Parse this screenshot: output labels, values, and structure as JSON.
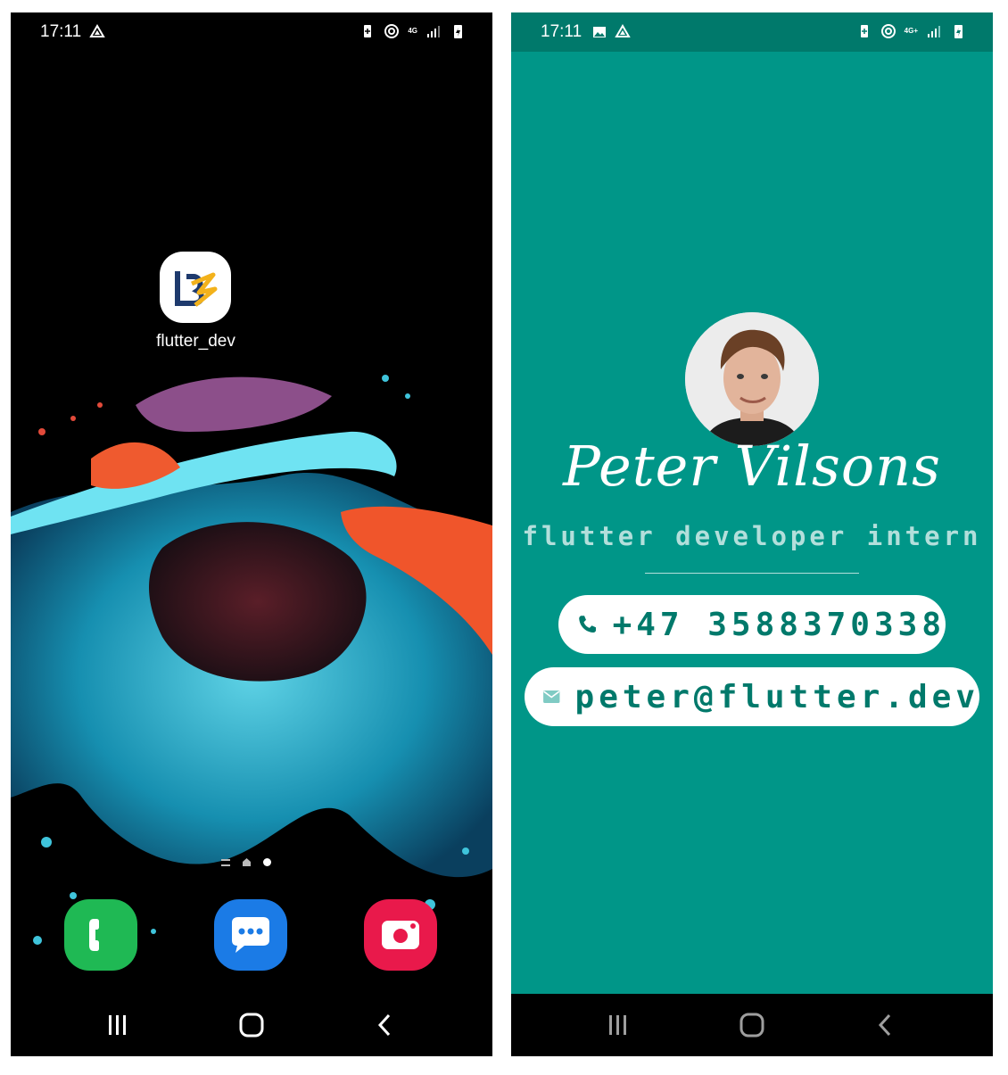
{
  "left_screen": {
    "status_bar": {
      "time": "17:11",
      "network": "4G",
      "icons_left": [
        "drive-icon"
      ],
      "icons_right": [
        "battery-saver-icon",
        "hotspot-icon",
        "signal-icon",
        "battery-icon"
      ]
    },
    "home": {
      "app_label": "flutter_dev",
      "page_indicator": [
        "menu",
        "home",
        "current"
      ]
    },
    "dock": [
      "phone-icon",
      "messages-icon",
      "camera-icon"
    ],
    "nav": [
      "recents-icon",
      "home-icon",
      "back-icon"
    ]
  },
  "right_screen": {
    "status_bar": {
      "time": "17:11",
      "network": "4G+",
      "icons_left": [
        "image-icon",
        "drive-icon"
      ],
      "icons_right": [
        "battery-saver-icon",
        "hotspot-icon",
        "signal-icon",
        "battery-icon"
      ]
    },
    "card": {
      "name": "Peter Vilsons",
      "title": "flutter developer intern",
      "phone": "+47 3588370338",
      "email": "peter@flutter.dev"
    },
    "nav": [
      "recents-icon",
      "home-icon",
      "back-icon"
    ]
  },
  "colors": {
    "teal": "#009688",
    "teal_dark": "#00796b",
    "teal_light": "#b2dfdb"
  }
}
